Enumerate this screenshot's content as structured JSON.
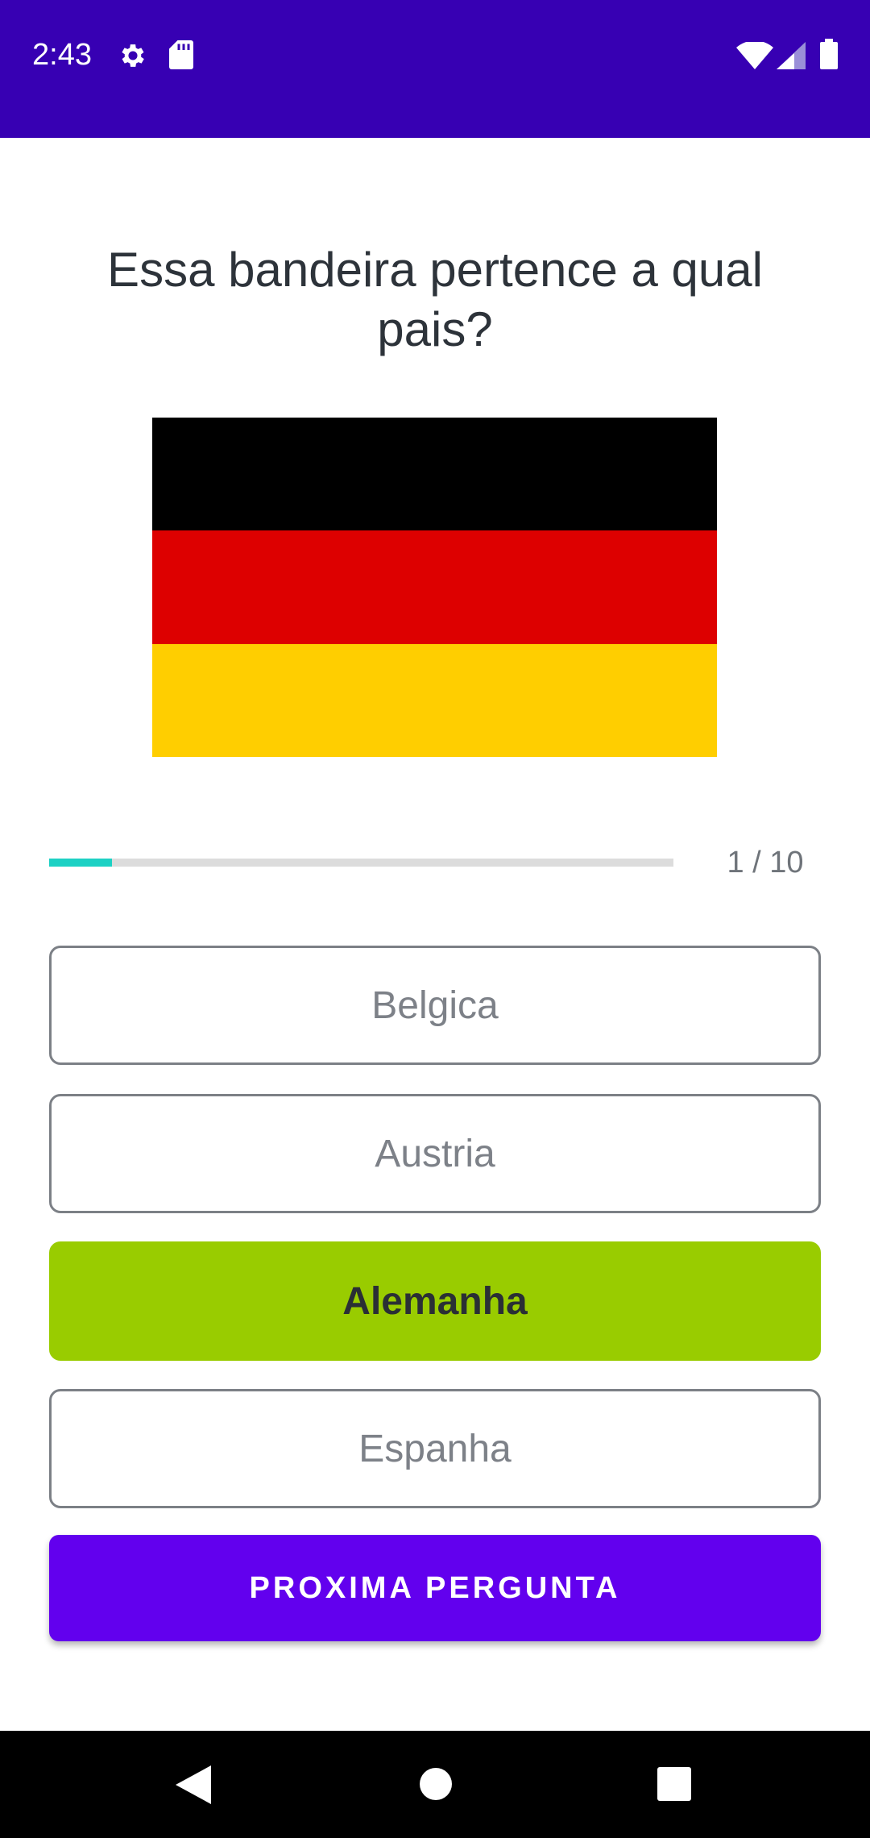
{
  "status_bar": {
    "time": "2:43",
    "color": "#3700b3",
    "icons": [
      "gear-icon",
      "sd-card-icon",
      "wifi-icon",
      "signal-icon",
      "battery-icon"
    ]
  },
  "quiz": {
    "question": "Essa bandeira pertence a qual pais?",
    "flag": {
      "name": "germany-flag",
      "stripes": [
        "#000000",
        "#dd0000",
        "#ffce00"
      ]
    },
    "progress": {
      "current": 1,
      "total": 10,
      "fraction": 0.1,
      "label": "1 / 10",
      "color": "#1dd1c4"
    },
    "options": [
      {
        "label": "Belgica",
        "state": "default"
      },
      {
        "label": "Austria",
        "state": "default"
      },
      {
        "label": "Alemanha",
        "state": "correct"
      },
      {
        "label": "Espanha",
        "state": "default"
      }
    ],
    "correct_color": "#99cc00",
    "next_label": "PROXIMA PERGUNTA",
    "next_color": "#6200ee"
  },
  "nav_bar": {
    "icons": [
      "back-icon",
      "home-icon",
      "recents-icon"
    ]
  }
}
